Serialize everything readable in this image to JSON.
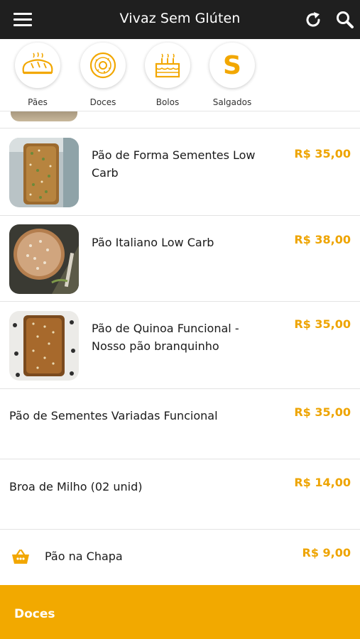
{
  "header": {
    "title": "Vivaz Sem Glúten"
  },
  "categories": [
    {
      "label": "Pães",
      "icon": "bread-icon"
    },
    {
      "label": "Doces",
      "icon": "donut-icon"
    },
    {
      "label": "Bolos",
      "icon": "cake-icon"
    },
    {
      "label": "Salgados",
      "icon": "salgados-s-icon",
      "glyph": "S"
    }
  ],
  "products": [
    {
      "name_line1": "Pão de Forma Sementes Low",
      "name_line2": "Carb",
      "price": "R$ 35,00",
      "has_image": true
    },
    {
      "name_line1": "Pão Italiano Low Carb",
      "name_line2": "",
      "price": "R$ 38,00",
      "has_image": true
    },
    {
      "name_line1": "Pão de Quinoa Funcional -",
      "name_line2": "Nosso pão branquinho",
      "price": "R$ 35,00",
      "has_image": true
    },
    {
      "name_line1": "Pão de Sementes Variadas Funcional",
      "name_line2": "",
      "price": "R$ 35,00",
      "has_image": false
    },
    {
      "name_line1": "Broa de Milho (02 unid)",
      "name_line2": "",
      "price": "R$ 14,00",
      "has_image": false
    },
    {
      "name_line1": "Pão na Chapa",
      "name_line2": "",
      "price": "R$ 9,00",
      "has_image": false,
      "icon": "basket-icon"
    }
  ],
  "bottom_section": {
    "label": "Doces"
  },
  "colors": {
    "accent": "#f2a900",
    "price": "#eea400",
    "topbar": "#1f1f1f"
  }
}
